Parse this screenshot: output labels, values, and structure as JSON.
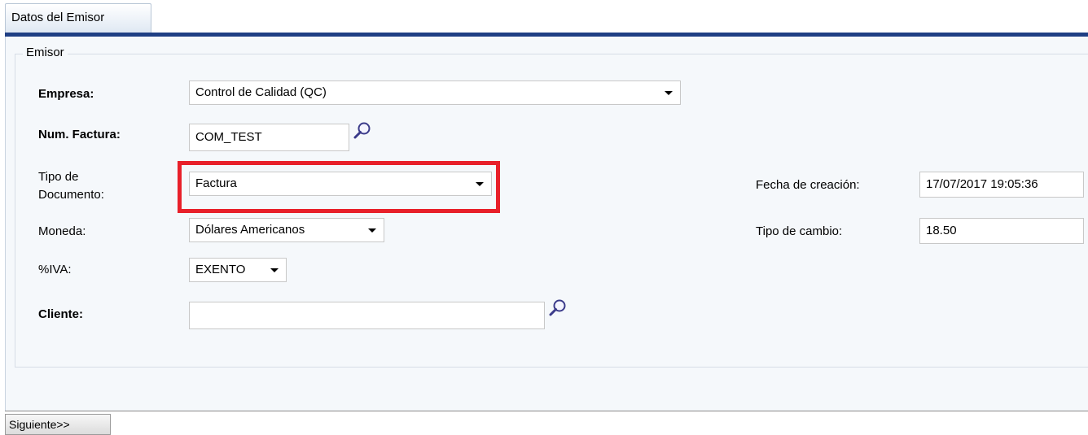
{
  "tabs": [
    {
      "label": "Datos del Emisor",
      "active": true
    }
  ],
  "section": {
    "legend": "Emisor"
  },
  "fields": {
    "empresa": {
      "label": "Empresa:",
      "value": "Control de Calidad (QC)"
    },
    "num_factura": {
      "label": "Num. Factura:",
      "value": "COM_TEST"
    },
    "tipo_documento": {
      "label_line1": "Tipo de",
      "label_line2": "Documento:",
      "value": "Factura"
    },
    "moneda": {
      "label": "Moneda:",
      "value": "Dólares Americanos"
    },
    "iva": {
      "label": "%IVA:",
      "value": "EXENTO"
    },
    "cliente": {
      "label": "Cliente:",
      "value": ""
    },
    "fecha_creacion": {
      "label": "Fecha de creación:",
      "value": "17/07/2017 19:05:36"
    },
    "tipo_cambio": {
      "label": "Tipo de cambio:",
      "value": "18.50"
    }
  },
  "buttons": {
    "next": "Siguiente>>"
  },
  "icons": {
    "search": "magnifier-icon",
    "dropdown": "caret-down-icon"
  },
  "colors": {
    "tab_bar": "#1f3f84",
    "highlight": "#e8202a",
    "panel_bg": "#f5f8fb"
  }
}
